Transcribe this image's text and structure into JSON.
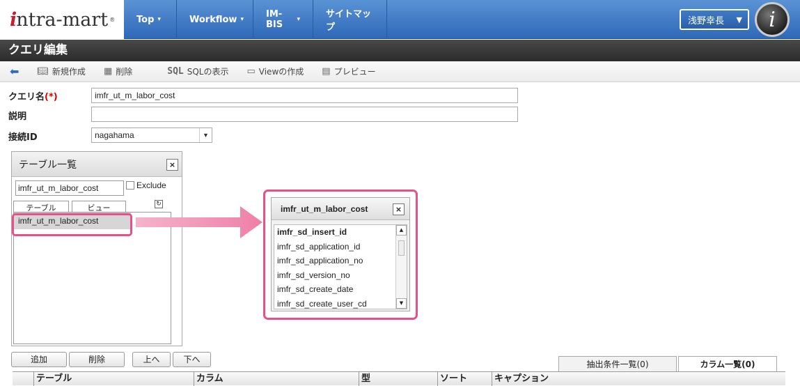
{
  "app": {
    "logo_text": "ntra-mart",
    "logo_i": "i",
    "logo_mark": "®"
  },
  "nav": [
    {
      "label": "Top",
      "caret": "▾"
    },
    {
      "label": "Workflow",
      "caret": "▾"
    },
    {
      "label": "IM-BIS",
      "caret": "▾"
    },
    {
      "label": "サイトマップ",
      "caret": ""
    }
  ],
  "user": {
    "name": "浅野幸長",
    "caret": "▼",
    "avatar_letter": "i"
  },
  "page_title": "クエリ編集",
  "toolbar": {
    "back_icon": "back-arrow-icon",
    "new_label": "新規作成",
    "delete_label": "削除",
    "sql_icon_text": "SQL",
    "sql_label": "SQLの表示",
    "view_label": "Viewの作成",
    "preview_label": "プレビュー"
  },
  "form": {
    "query_name_label": "クエリ名",
    "required_mark": "(*)",
    "query_name_value": "imfr_ut_m_labor_cost",
    "description_label": "説明",
    "description_value": "",
    "connection_label": "接続ID",
    "connection_value": "nagahama"
  },
  "table_panel": {
    "title": "テーブル一覧",
    "close": "×",
    "search_value": "imfr_ut_m_labor_cost",
    "exclude_label": "Exclude",
    "tab_table": "テーブル",
    "tab_view": "ビュー",
    "refresh_icon": "refresh-icon",
    "items": [
      "imfr_ut_m_labor_cost"
    ]
  },
  "column_panel": {
    "title": "imfr_ut_m_labor_cost",
    "close": "×",
    "columns": [
      "imfr_sd_insert_id",
      "imfr_sd_application_id",
      "imfr_sd_application_no",
      "imfr_sd_version_no",
      "imfr_sd_create_date",
      "imfr_sd_create_user_cd"
    ]
  },
  "buttons": {
    "add": "追加",
    "delete": "削除",
    "up": "上へ",
    "down": "下へ"
  },
  "right_tabs": {
    "conditions": "抽出条件一覧(0)",
    "columns": "カラム一覧(0)"
  },
  "grid_headers": [
    "テーブル",
    "カラム",
    "型",
    "ソート",
    "キャプション"
  ],
  "colors": {
    "highlight": "#e8508a",
    "nav_blue": "#2f68b8",
    "title_dark": "#2b2b2b"
  }
}
